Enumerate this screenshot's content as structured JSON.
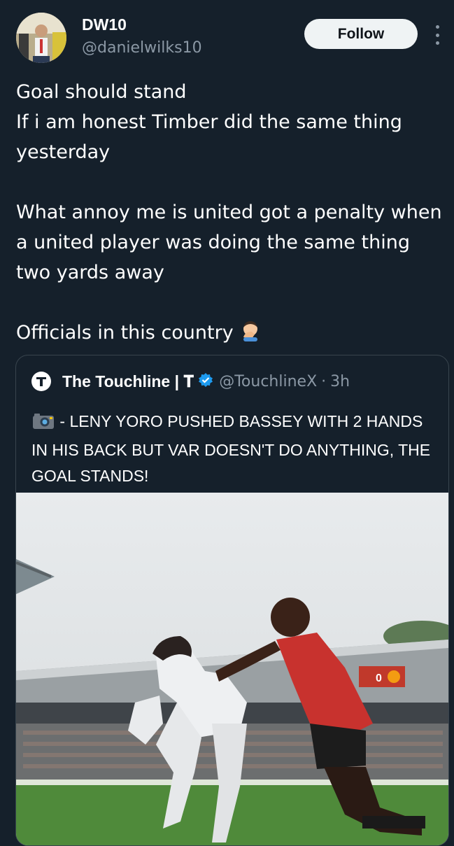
{
  "user": {
    "display_name": "DW10",
    "handle": "@danielwilks10",
    "follow_label": "Follow"
  },
  "tweet": {
    "line1": "Goal should stand",
    "line2": "If i am honest Timber did the same thing yesterday",
    "line3": "What annoy me is united got a penalty when a united player was doing the same thing two yards away",
    "line4": "Officials in this country"
  },
  "quoted": {
    "name": "The Touchline | 𝐓",
    "handle": "@TouchlineX",
    "separator": "·",
    "time": "3h",
    "text": "- LENY YORO PUSHED BASSEY WITH 2 HANDS IN HIS BACK BUT VAR DOESN'T DO ANYTHING, THE GOAL STANDS!"
  },
  "scoreboard": {
    "score": "0"
  },
  "colors": {
    "background": "#15202b",
    "muted": "#8b98a5",
    "verified": "#1d9bf0",
    "button_bg": "#eff3f4"
  }
}
